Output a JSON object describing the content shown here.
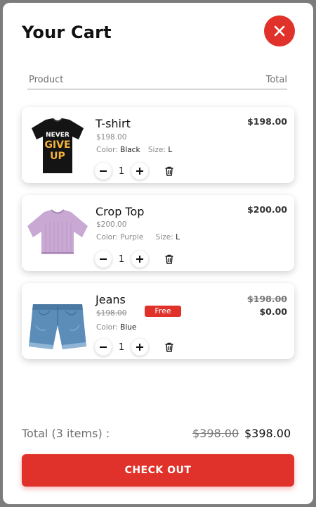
{
  "header": {
    "title": "Your Cart"
  },
  "columns": {
    "product": "Product",
    "total": "Total"
  },
  "items": [
    {
      "name": "T-shirt",
      "unit_price": "$198.00",
      "color_label": "Color:",
      "color": "Black",
      "size_label": "Size:",
      "size": "L",
      "quantity": "1",
      "total": "$198.00",
      "image_icon": "black-tshirt-never-give-up"
    },
    {
      "name": "Crop Top",
      "unit_price": "$200.00",
      "color_label": "Color:",
      "color": "Purple",
      "size_label": "Size:",
      "size": "L",
      "quantity": "1",
      "total": "$200.00",
      "image_icon": "lavender-crop-top"
    },
    {
      "name": "Jeans",
      "unit_price": "$198.00",
      "badge": "Free",
      "color_label": "Color:",
      "color": "Blue",
      "quantity": "1",
      "original_total": "$198.00",
      "total": "$0.00",
      "image_icon": "denim-shorts"
    }
  ],
  "tshirt_print": {
    "line1": "NEVER",
    "line2": "GIVE",
    "line3": "UP"
  },
  "summary": {
    "label": "Total (3 items) :",
    "original_total": "$398.00",
    "total": "$398.00"
  },
  "checkout_label": "CHECK OUT",
  "colors": {
    "accent": "#e0322a",
    "text": "#111111",
    "muted": "#8a8a8a",
    "background": "#ffffff",
    "frame": "#7c7c7c"
  }
}
